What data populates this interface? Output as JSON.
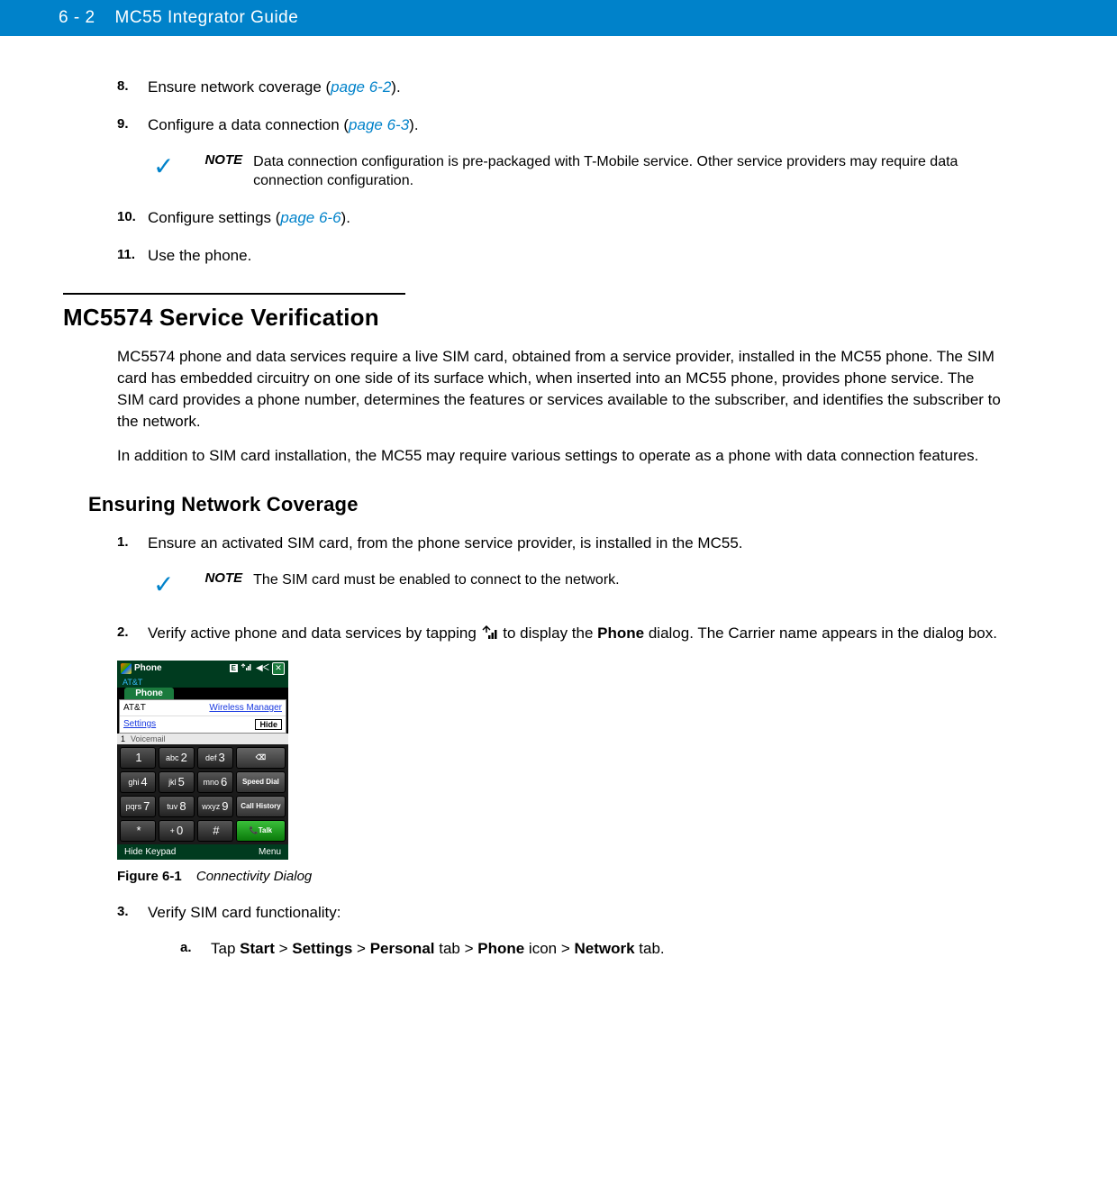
{
  "header": {
    "page_num": "6 - 2",
    "title": "MC55 Integrator Guide"
  },
  "steps_top": {
    "s8": {
      "num": "8.",
      "pre": "Ensure network coverage (",
      "link": "page 6-2",
      "post": ")."
    },
    "s9": {
      "num": "9.",
      "pre": "Configure a data connection (",
      "link": "page 6-3",
      "post": ")."
    },
    "note1": {
      "label": "NOTE",
      "text": "Data connection configuration is pre-packaged with T-Mobile service. Other service providers may require data connection configuration."
    },
    "s10": {
      "num": "10.",
      "pre": "Configure settings (",
      "link": "page 6-6",
      "post": ")."
    },
    "s11": {
      "num": "11.",
      "text": "Use the phone."
    }
  },
  "section": {
    "h2": "MC5574 Service Verification",
    "p1": "MC5574 phone and data services require a live SIM card, obtained from a service provider, installed in the MC55 phone. The SIM card has embedded circuitry on one side of its surface which, when inserted into an MC55 phone, provides phone service. The SIM card provides a phone number, determines the features or services available to the subscriber, and identifies the subscriber to the network.",
    "p2": "In addition to SIM card installation, the MC55 may require various settings to operate as a phone with data connection features."
  },
  "subsection": {
    "h3": "Ensuring Network Coverage",
    "s1": {
      "num": "1.",
      "text": "Ensure an activated SIM card, from the phone service provider, is installed in the MC55."
    },
    "note2": {
      "label": "NOTE",
      "text": "The SIM card must be enabled to connect to the network."
    },
    "s2": {
      "num": "2.",
      "pre": "Verify active phone and data services by tapping ",
      "mid": " to display the ",
      "bold1": "Phone",
      "post": " dialog. The Carrier name appears in the dialog box."
    },
    "s3": {
      "num": "3.",
      "text": "Verify SIM card functionality:"
    },
    "s3a": {
      "num": "a.",
      "pre": "Tap ",
      "b1": "Start",
      "g1": " > ",
      "b2": "Settings",
      "g2": " > ",
      "b3": "Personal",
      "g3": " tab > ",
      "b4": "Phone",
      "g4": " icon > ",
      "b5": "Network",
      "g5": " tab."
    }
  },
  "figure": {
    "label": "Figure 6-1",
    "caption": "Connectivity Dialog"
  },
  "phone": {
    "app": "Phone",
    "status_e": "E",
    "carrier_strip": "AT&T",
    "popup_tab": "Phone",
    "carrier": "AT&T",
    "wireless_mgr": "Wireless Manager",
    "settings": "Settings",
    "hide": "Hide",
    "vm_num": "1",
    "vm_label": "Voicemail",
    "keys": {
      "k1": "1",
      "k2a": "abc",
      "k2b": "2",
      "k3a": "def",
      "k3b": "3",
      "k4a": "ghi",
      "k4b": "4",
      "k5a": "jkl",
      "k5b": "5",
      "k6a": "mno",
      "k6b": "6",
      "k7a": "pqrs",
      "k7b": "7",
      "k8a": "tuv",
      "k8b": "8",
      "k9a": "wxyz",
      "k9b": "9",
      "kstar": "*",
      "k0a": "+",
      "k0b": "0",
      "khash": "#",
      "speed": "Speed Dial",
      "hist": "Call History",
      "talk": "Talk"
    },
    "soft_left": "Hide Keypad",
    "soft_right": "Menu"
  }
}
